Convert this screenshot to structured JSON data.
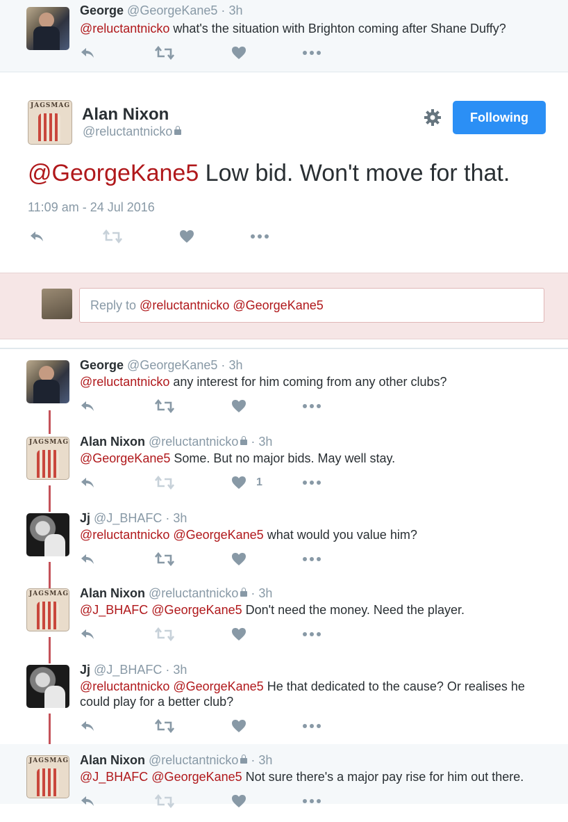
{
  "top_tweet": {
    "name": "George",
    "handle": "@GeorgeKane5",
    "time": "3h",
    "mention": "@reluctantnicko",
    "text": " what's the situation with Brighton coming after Shane Duffy?"
  },
  "main_tweet": {
    "name": "Alan Nixon",
    "handle": "@reluctantnicko",
    "follow_label": "Following",
    "mention": "@GeorgeKane5",
    "text": " Low bid. Won't move for that.",
    "timestamp": "11:09 am - 24 Jul 2016"
  },
  "reply_box": {
    "prefix": "Reply to ",
    "mentions": "@reluctantnicko @GeorgeKane5"
  },
  "replies": [
    {
      "name": "George",
      "handle": "@GeorgeKane5",
      "time": "3h",
      "mentions": "@reluctantnicko",
      "text": " any interest for him coming from any other clubs?",
      "like_count": ""
    },
    {
      "name": "Alan Nixon",
      "handle": "@reluctantnicko",
      "time": "3h",
      "mentions": "@GeorgeKane5",
      "text": " Some. But no major bids. May well stay.",
      "like_count": "1"
    },
    {
      "name": "Jj",
      "handle": "@J_BHAFC",
      "time": "3h",
      "mentions": "@reluctantnicko @GeorgeKane5",
      "text": " what would you value him?",
      "like_count": ""
    },
    {
      "name": "Alan Nixon",
      "handle": "@reluctantnicko",
      "time": "3h",
      "mentions": "@J_BHAFC @GeorgeKane5",
      "text": " Don't need the money. Need the player.",
      "like_count": ""
    },
    {
      "name": "Jj",
      "handle": "@J_BHAFC",
      "time": "3h",
      "mentions": "@reluctantnicko @GeorgeKane5",
      "text": " He that dedicated to the cause? Or realises he",
      "text2": "could play for a better club?",
      "like_count": ""
    },
    {
      "name": "Alan Nixon",
      "handle": "@reluctantnicko",
      "time": "3h",
      "mentions": "@J_BHAFC @GeorgeKane5",
      "text": " Not sure there's a major pay rise for him out there.",
      "like_count": ""
    }
  ],
  "avatar_mast_text": "JAGSMAG",
  "colors": {
    "mention": "#b0181b",
    "follow_button": "#2b8ff5",
    "reply_area_bg": "#f6e6e6",
    "thread_line": "#c4525a"
  }
}
